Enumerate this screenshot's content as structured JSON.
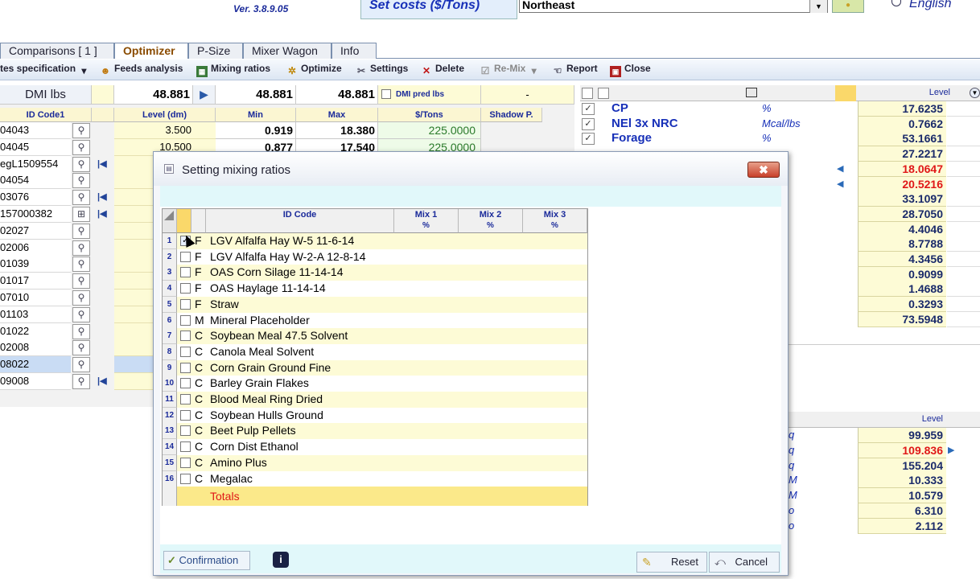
{
  "header": {
    "version": "Ver. 3.8.9.05",
    "set_costs_label": "Set costs ($/Tons)",
    "region_value": "Northeast",
    "language_label": "English"
  },
  "tabs": [
    {
      "label": "Comparisons [ 1 ]",
      "active": false
    },
    {
      "label": "Optimizer",
      "active": true
    },
    {
      "label": "P-Size",
      "active": false
    },
    {
      "label": "Mixer Wagon",
      "active": false
    },
    {
      "label": "Info",
      "active": false
    }
  ],
  "toolbar": {
    "items": [
      {
        "label": "tes specification",
        "icon": "dropdown-icon"
      },
      {
        "label": "Feeds analysis",
        "icon": "person-icon"
      },
      {
        "label": "Mixing ratios",
        "icon": "mixing-icon"
      },
      {
        "label": "Optimize",
        "icon": "optimize-icon"
      },
      {
        "label": "Settings",
        "icon": "wrench-icon"
      },
      {
        "label": "Delete",
        "icon": "x-icon"
      },
      {
        "label": "Re-Mix",
        "icon": "remix-icon"
      },
      {
        "label": "Report",
        "icon": "report-icon"
      },
      {
        "label": "Close",
        "icon": "close-icon"
      }
    ]
  },
  "left_grid": {
    "dmi_label": "DMI lbs",
    "dmi_value_1": "48.881",
    "dmi_value_2": "48.881",
    "dmi_value_3": "48.881",
    "dmi_pred_label": "DMI pred lbs",
    "dmi_pred_value": "-",
    "columns": [
      "ID Code1",
      "Level (dm)",
      "Min",
      "Max",
      "$/Tons",
      "Shadow P."
    ],
    "rows": [
      {
        "id": "04043",
        "level": "3.500",
        "min": "0.919",
        "max": "18.380",
        "cost": "225.0000"
      },
      {
        "id": "04045",
        "level": "10.500",
        "min": "0.877",
        "max": "17.540",
        "cost": "225.0000"
      },
      {
        "id": "egL1509554"
      },
      {
        "id": "04054"
      },
      {
        "id": "03076"
      },
      {
        "id": "157000382"
      },
      {
        "id": "02027"
      },
      {
        "id": "02006"
      },
      {
        "id": "01039"
      },
      {
        "id": "01017"
      },
      {
        "id": "07010"
      },
      {
        "id": "01103"
      },
      {
        "id": "01022"
      },
      {
        "id": "02008"
      },
      {
        "id": "08022"
      },
      {
        "id": "09008"
      }
    ]
  },
  "right_grid": {
    "level_label": "Level",
    "rows": [
      {
        "name": "CP",
        "unit": "%",
        "value": "17.6235",
        "red": false
      },
      {
        "name": "NEl 3x NRC",
        "unit": "Mcal/lbs",
        "value": "0.7662",
        "red": false
      },
      {
        "name": "Forage",
        "unit": "%",
        "value": "53.1661",
        "red": false
      },
      {
        "name": "",
        "unit": "",
        "value": "27.2217",
        "red": false
      },
      {
        "name": "",
        "unit": "",
        "value": "18.0647",
        "red": true
      },
      {
        "name": "",
        "unit": "",
        "value": "20.5216",
        "red": true
      },
      {
        "name": "",
        "unit": "",
        "value": "33.1097",
        "red": false
      },
      {
        "name": "",
        "unit": "",
        "value": "28.7050",
        "red": false
      },
      {
        "name": "",
        "unit": "",
        "value": "4.4046",
        "red": false
      },
      {
        "name": "",
        "unit": "",
        "value": "8.7788",
        "red": false
      },
      {
        "name": "",
        "unit": "",
        "value": "4.3456",
        "red": false
      },
      {
        "name": "",
        "unit": "",
        "value": "0.9099",
        "red": false
      },
      {
        "name": "",
        "unit": "",
        "value": "1.4688",
        "red": false
      },
      {
        "name": "",
        "unit": "",
        "value": "0.3293",
        "red": false
      },
      {
        "name": "",
        "unit": "",
        "value": "73.5948",
        "red": false
      }
    ]
  },
  "bottom_right": {
    "level_label": "Level",
    "rows": [
      {
        "unit": "q",
        "value": "99.959",
        "red": false
      },
      {
        "unit": "q",
        "value": "109.836",
        "red": true
      },
      {
        "unit": "q",
        "value": "155.204",
        "red": false
      },
      {
        "unit": "M",
        "value": "10.333",
        "red": false
      },
      {
        "unit": "M",
        "value": "10.579",
        "red": false
      },
      {
        "unit": "o",
        "value": "6.310",
        "red": false
      },
      {
        "unit": "o",
        "value": "2.112",
        "red": false
      }
    ]
  },
  "modal": {
    "title": "Setting mixing ratios",
    "close_label": "✖",
    "columns": {
      "id_code": "ID Code",
      "mix1": "Mix 1",
      "mix2": "Mix 2",
      "mix3": "Mix 3",
      "unit": "%"
    },
    "rows": [
      {
        "num": "1",
        "type": "F",
        "name": "LGV Alfalfa Hay W-5 11-6-14",
        "checked": true
      },
      {
        "num": "2",
        "type": "F",
        "name": "LGV Alfalfa Hay W-2-A 12-8-14",
        "checked": false
      },
      {
        "num": "3",
        "type": "F",
        "name": "OAS Corn Silage 11-14-14",
        "checked": false
      },
      {
        "num": "4",
        "type": "F",
        "name": "OAS Haylage 11-14-14",
        "checked": false
      },
      {
        "num": "5",
        "type": "F",
        "name": "Straw",
        "checked": false
      },
      {
        "num": "6",
        "type": "M",
        "name": "Mineral Placeholder",
        "checked": false
      },
      {
        "num": "7",
        "type": "C",
        "name": "Soybean Meal 47.5 Solvent",
        "checked": false
      },
      {
        "num": "8",
        "type": "C",
        "name": "Canola Meal Solvent",
        "checked": false
      },
      {
        "num": "9",
        "type": "C",
        "name": "Corn Grain Ground Fine",
        "checked": false
      },
      {
        "num": "10",
        "type": "C",
        "name": "Barley Grain Flakes",
        "checked": false
      },
      {
        "num": "11",
        "type": "C",
        "name": "Blood Meal Ring Dried",
        "checked": false
      },
      {
        "num": "12",
        "type": "C",
        "name": "Soybean Hulls Ground",
        "checked": false
      },
      {
        "num": "13",
        "type": "C",
        "name": "Beet Pulp Pellets",
        "checked": false
      },
      {
        "num": "14",
        "type": "C",
        "name": "Corn Dist Ethanol",
        "checked": false
      },
      {
        "num": "15",
        "type": "C",
        "name": "Amino Plus",
        "checked": false
      },
      {
        "num": "16",
        "type": "C",
        "name": "Megalac",
        "checked": false
      }
    ],
    "totals_label": "Totals",
    "confirm_label": "Confirmation",
    "info_label": "i",
    "reset_label": "Reset",
    "cancel_label": "Cancel"
  },
  "colors": {
    "accent_blue": "#1730b8",
    "highlight_red": "#e01818",
    "cell_yellow": "#fdfbd6",
    "modal_band": "#e1f8fa"
  }
}
